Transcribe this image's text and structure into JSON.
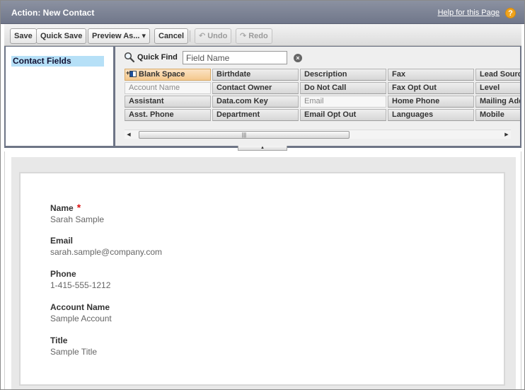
{
  "header": {
    "title": "Action: New Contact",
    "help_link": "Help for this Page",
    "help_icon": "?"
  },
  "toolbar": {
    "save": "Save",
    "quick_save": "Quick Save",
    "preview_as": "Preview As...",
    "cancel": "Cancel",
    "undo": "Undo",
    "redo": "Redo"
  },
  "left_panel": {
    "selected_category": "Contact Fields"
  },
  "quick_find": {
    "label": "Quick Find",
    "placeholder": "Field Name",
    "value": ""
  },
  "palette": {
    "row1": [
      "Blank Space",
      "Birthdate",
      "Description",
      "Fax",
      "Lead Source"
    ],
    "row2": [
      "Account Name",
      "Contact Owner",
      "Do Not Call",
      "Fax Opt Out",
      "Level"
    ],
    "row3": [
      "Assistant",
      "Data.com Key",
      "Email",
      "Home Phone",
      "Mailing Address"
    ],
    "row4": [
      "Asst. Phone",
      "Department",
      "Email Opt Out",
      "Languages",
      "Mobile"
    ],
    "used_fields": [
      "Account Name",
      "Email"
    ]
  },
  "layout": {
    "fields": [
      {
        "label": "Name",
        "value": "Sarah Sample",
        "required": true
      },
      {
        "label": "Email",
        "value": "sarah.sample@company.com",
        "required": false
      },
      {
        "label": "Phone",
        "value": "1-415-555-1212",
        "required": false
      },
      {
        "label": "Account Name",
        "value": "Sample Account",
        "required": false
      },
      {
        "label": "Title",
        "value": "Sample Title",
        "required": false
      }
    ],
    "required_marker": "*"
  },
  "colors": {
    "header_bg": "#7d8496",
    "selected_category_bg": "#b6e0f7",
    "blank_space_bg": "#f4c88d",
    "required": "#dd1111",
    "help_icon": "#f0a31c"
  }
}
